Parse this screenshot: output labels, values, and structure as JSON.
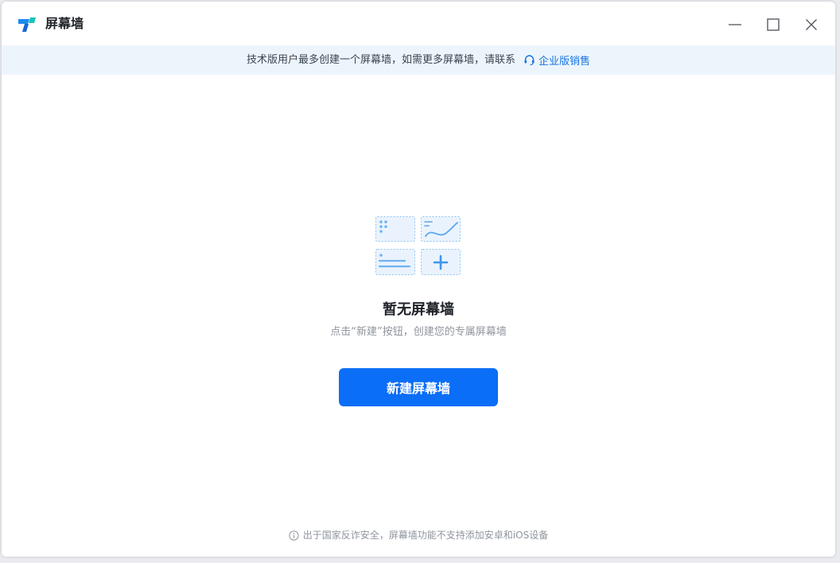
{
  "window": {
    "title": "屏幕墙"
  },
  "notice": {
    "text": "技术版用户最多创建一个屏幕墙，如需更多屏幕墙，请联系",
    "link_label": "企业版销售"
  },
  "empty_state": {
    "title": "暂无屏幕墙",
    "subtitle": "点击“新建”按钮，创建您的专属屏幕墙",
    "button_label": "新建屏幕墙"
  },
  "footer": {
    "note": "出于国家反诈安全，屏幕墙功能不支持添加安卓和iOS设备"
  },
  "colors": {
    "accent": "#0b6ef7",
    "link": "#1774e0",
    "notice_bg": "#edf5fc"
  },
  "icons": {
    "app_logo": "app-logo-icon",
    "minimize": "minimize-icon",
    "maximize": "maximize-icon",
    "close": "close-icon",
    "headset": "headset-icon",
    "info": "info-icon",
    "empty": "screen-wall-empty-icon"
  }
}
